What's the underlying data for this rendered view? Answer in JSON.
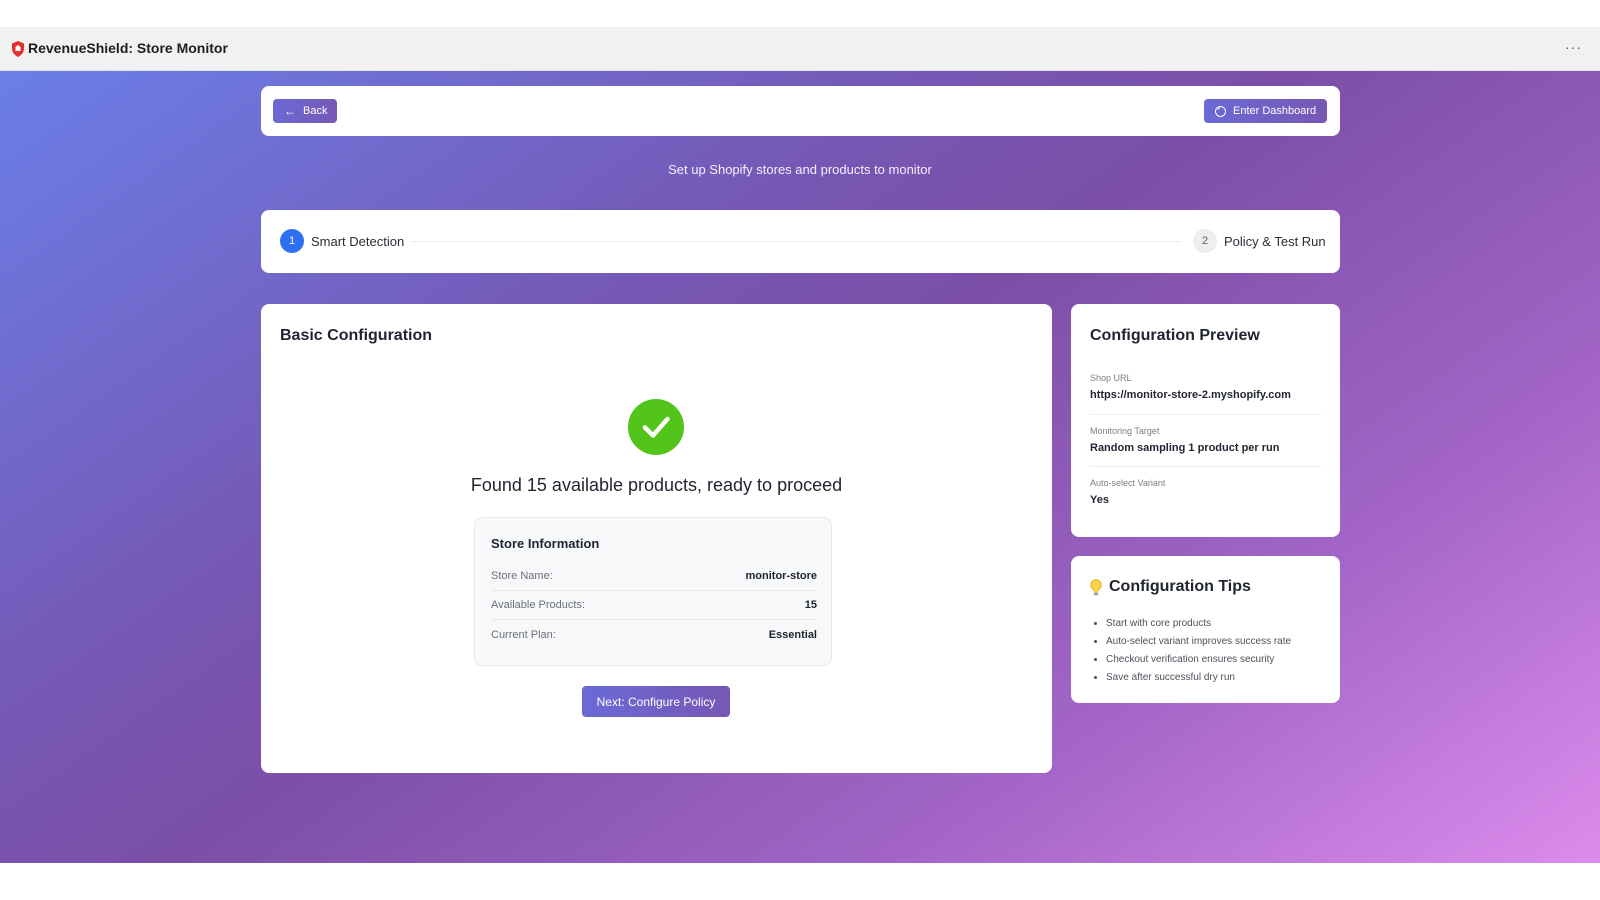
{
  "window": {
    "title": "RevenueShield: Store Monitor",
    "more_label": "···"
  },
  "nav": {
    "back_label": "Back",
    "dashboard_label": "Enter Dashboard"
  },
  "subtitle": "Set up Shopify stores and products to monitor",
  "steps": [
    {
      "number": "1",
      "label": "Smart Detection",
      "active": true
    },
    {
      "number": "2",
      "label": "Policy & Test Run",
      "active": false
    }
  ],
  "main": {
    "title": "Basic Configuration",
    "status_message": "Found 15 available products, ready to proceed",
    "store_info": {
      "title": "Store Information",
      "rows": [
        {
          "key": "Store Name:",
          "value": "monitor-store"
        },
        {
          "key": "Available Products:",
          "value": "15"
        },
        {
          "key": "Current Plan:",
          "value": "Essential"
        }
      ]
    },
    "next_label": "Next: Configure Policy"
  },
  "preview": {
    "title": "Configuration Preview",
    "fields": [
      {
        "label": "Shop URL",
        "value": "https://monitor-store-2.myshopify.com"
      },
      {
        "label": "Monitoring Target",
        "value": "Random sampling 1 product per run"
      },
      {
        "label": "Auto-select Variant",
        "value": "Yes"
      }
    ]
  },
  "tips": {
    "title": "Configuration Tips",
    "items": [
      "Start with core products",
      "Auto-select variant improves success rate",
      "Checkout verification ensures security",
      "Save after successful dry run"
    ]
  },
  "colors": {
    "accent_blue": "#2f6ff2",
    "success_green": "#52c41a",
    "button_gradient_start": "#6a6ad6",
    "button_gradient_end": "#7757b4",
    "logo_red": "#e0312f"
  }
}
